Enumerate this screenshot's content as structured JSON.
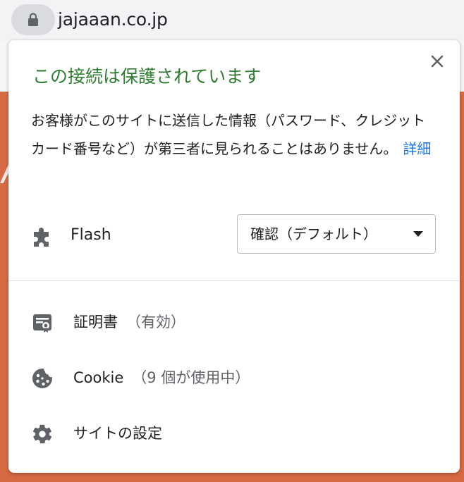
{
  "browser": {
    "url": "jajaaan.co.jp",
    "lock_icon": "lock-icon"
  },
  "popup": {
    "title": "この接続は保護されています",
    "description": "お客様がこのサイトに送信した情報（パスワード、クレジット カード番号など）が第三者に見られることはありません。",
    "details_link": "詳細",
    "close_icon": "close-icon",
    "flash": {
      "icon": "puzzle-icon",
      "label": "Flash",
      "selected": "確認（デフォルト）"
    },
    "menu": {
      "certificate": {
        "icon": "certificate-icon",
        "label": "証明書",
        "sub": "（有効）"
      },
      "cookie": {
        "icon": "cookie-icon",
        "label": "Cookie",
        "sub": "（9 個が使用中）"
      },
      "site_settings": {
        "icon": "gear-icon",
        "label": "サイトの設定"
      }
    }
  },
  "colors": {
    "title_green": "#2f7d32",
    "link_blue": "#1a73e8",
    "page_orange": "#d86a43"
  }
}
